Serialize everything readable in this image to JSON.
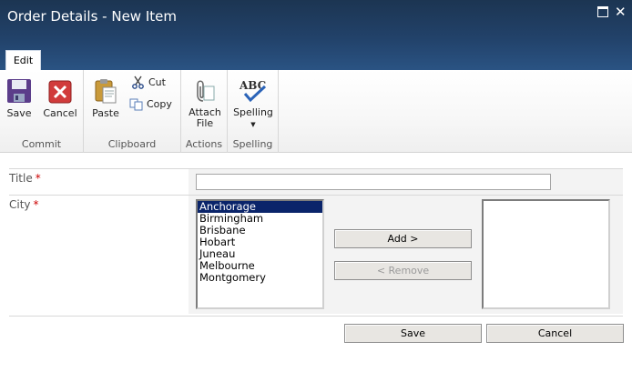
{
  "window": {
    "title": "Order Details - New Item"
  },
  "tabs": [
    {
      "label": "Edit"
    }
  ],
  "ribbon": {
    "commit": {
      "group_label": "Commit",
      "save": "Save",
      "cancel": "Cancel"
    },
    "clipboard": {
      "group_label": "Clipboard",
      "paste": "Paste",
      "cut": "Cut",
      "copy": "Copy"
    },
    "actions": {
      "group_label": "Actions",
      "attach_line1": "Attach",
      "attach_line2": "File"
    },
    "spelling": {
      "group_label": "Spelling",
      "spelling": "Spelling",
      "icon_text": "ABC"
    }
  },
  "form": {
    "title_field": {
      "label": "Title",
      "required_marker": "*",
      "value": ""
    },
    "city_field": {
      "label": "City",
      "required_marker": "*",
      "available_options": [
        "Anchorage",
        "Birmingham",
        "Brisbane",
        "Hobart",
        "Juneau",
        "Melbourne",
        "Montgomery"
      ],
      "selected_index": 0,
      "chosen_options": [],
      "add_button": "Add >",
      "remove_button": "< Remove"
    },
    "save_button": "Save",
    "cancel_button": "Cancel"
  },
  "colors": {
    "title_bar": "#22426a",
    "selection": "#0a246a",
    "required": "#cc0000"
  }
}
